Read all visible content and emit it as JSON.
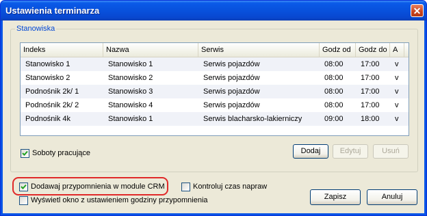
{
  "window": {
    "title": "Ustawienia terminarza"
  },
  "group": {
    "label": "Stanowiska"
  },
  "table": {
    "columns": [
      "Indeks",
      "Nazwa",
      "Serwis",
      "Godz od",
      "Godz do",
      "A"
    ],
    "rows": [
      [
        "Stanowisko 1",
        "Stanowisko 1",
        "Serwis pojazdów",
        "08:00",
        "17:00",
        "v"
      ],
      [
        "Stanowisko 2",
        "Stanowisko 2",
        "Serwis pojazdów",
        "08:00",
        "17:00",
        "v"
      ],
      [
        "Podnośnik 2k/ 1",
        "Stanowisko 3",
        "Serwis pojazdów",
        "08:00",
        "17:00",
        "v"
      ],
      [
        "Podnośnik 2k/ 2",
        "Stanowisko 4",
        "Serwis pojazdów",
        "08:00",
        "17:00",
        "v"
      ],
      [
        "Podnośnik 4k",
        "Stanowisko 1",
        "Serwis blacharsko-lakierniczy",
        "09:00",
        "18:00",
        "v"
      ]
    ]
  },
  "checkboxes": {
    "soboty": {
      "label": "Soboty pracujące",
      "checked": true
    },
    "przypomnienia": {
      "label": "Dodawaj przypomnienia w module CRM",
      "checked": true
    },
    "kontroluj": {
      "label": "Kontroluj czas napraw",
      "checked": false
    },
    "okno": {
      "label": "Wyświetl okno z ustawieniem godziny przypomnienia",
      "checked": false
    }
  },
  "buttons": {
    "dodaj": "Dodaj",
    "edytuj": "Edytuj",
    "usun": "Usuń",
    "zapisz": "Zapisz",
    "anuluj": "Anuluj",
    "close": "✕"
  },
  "colors": {
    "titlebar": "#0a54e6",
    "highlight": "#e02828",
    "group_label": "#0046d5"
  }
}
